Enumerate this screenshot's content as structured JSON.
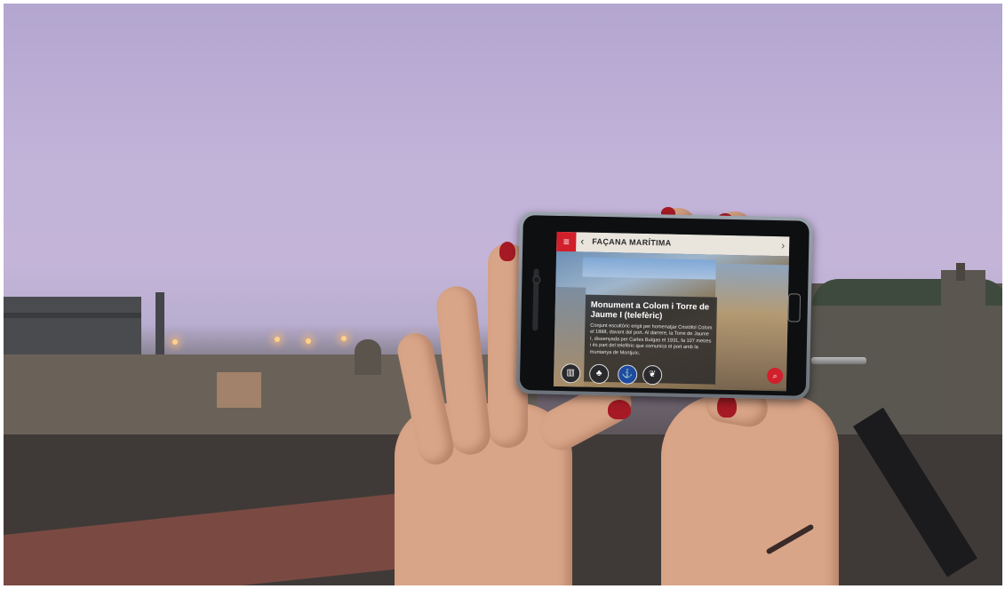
{
  "app": {
    "title": "FAÇANA MARÍTIMA",
    "menu_icon": "hamburger-menu-icon",
    "back_icon": "chevron-left-icon",
    "next_icon": "chevron-right-icon"
  },
  "poi": {
    "title": "Monument a Colom i Torre de Jaume I (telefèric)",
    "description": "Conjunt escultòric erigit per homenatjar Cristòfol Colom el 1888, davant del port. Al darrere, la Torre de Jaume I, dissenyada per Carles Buïgas el 1931, fa 107 metres i és part del telefèric que comunica el port amb la muntanya de Montjuïc."
  },
  "categories": [
    {
      "icon": "museum-icon",
      "glyph": "▥"
    },
    {
      "icon": "tree-icon",
      "glyph": "♣"
    },
    {
      "icon": "anchor-icon",
      "glyph": "⚓"
    },
    {
      "icon": "leaf-icon",
      "glyph": "❦"
    }
  ],
  "actions": {
    "search_icon": "search-zoom-icon",
    "collapse_icon": "minus-icon"
  },
  "colors": {
    "accent": "#d11f2b",
    "selected_category": "#1e4aa0",
    "topbar": "#e9e4dc"
  }
}
